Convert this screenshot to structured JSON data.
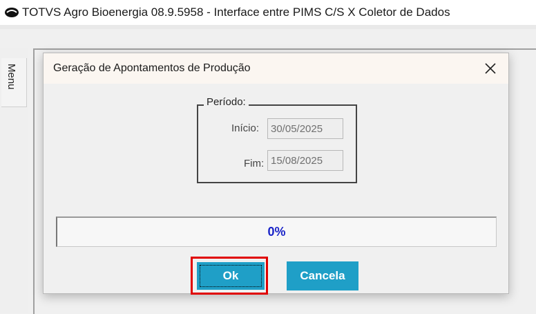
{
  "window": {
    "title": "TOTVS Agro Bioenergia 08.9.5958 - Interface entre PIMS C/S X Coletor de Dados"
  },
  "side_menu": {
    "label": "Menu"
  },
  "dialog": {
    "title": "Geração de Apontamentos de Produção",
    "periodo": {
      "legend": "Período:",
      "inicio_label": "Início:",
      "inicio_value": "30/05/2025",
      "fim_label": "Fim:",
      "fim_value": "15/08/2025"
    },
    "progress": {
      "text": "0%",
      "value": 0
    },
    "buttons": {
      "ok": "Ok",
      "cancel": "Cancela"
    }
  },
  "colors": {
    "button_bg": "#1f9fc7",
    "progress_text": "#1a24c8",
    "highlight": "#e00000"
  },
  "icons": [
    "totvs-logo-icon",
    "close-icon"
  ]
}
